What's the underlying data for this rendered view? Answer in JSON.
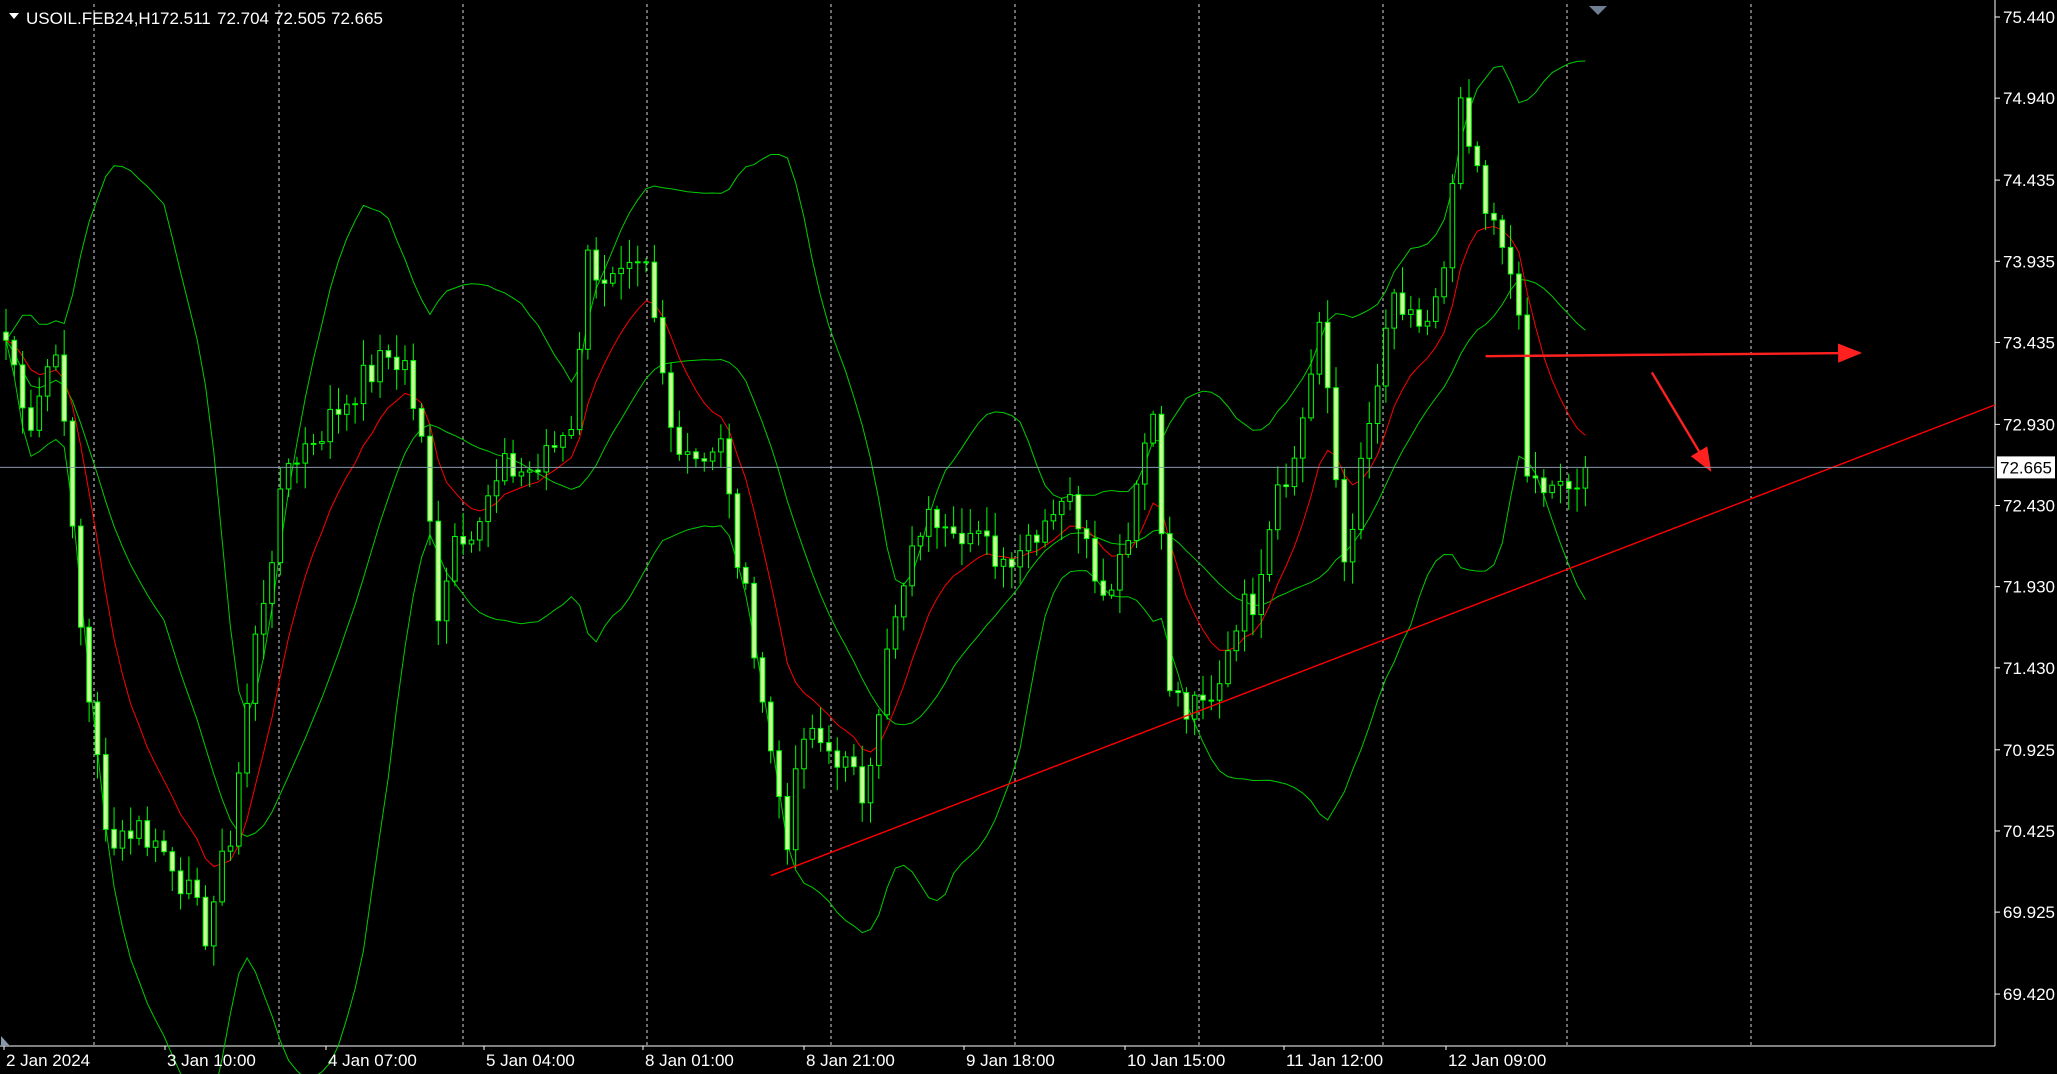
{
  "window": {
    "symbol_label": "USOIL.FEB24,H1",
    "ohlc": {
      "open": "72.511",
      "high": "72.704",
      "low": "72.505",
      "close": "72.665"
    },
    "current_price_label": "72.665"
  },
  "colors": {
    "background": "#000000",
    "grid": "#ffffff",
    "candle": "#00ff00",
    "candle_bull_body": "#000000",
    "candle_bear_body": "#ccff99",
    "bollinger": "#00cc00",
    "moving_average": "#ff0000",
    "trendline": "#ff0000",
    "arrow": "#ff2020",
    "price_line": "#8899aa"
  },
  "chart_data": {
    "type": "candlestick",
    "ylim": [
      69.1,
      75.52
    ],
    "y_ticks": [
      "75.440",
      "74.940",
      "74.435",
      "73.935",
      "73.435",
      "72.930",
      "72.430",
      "71.930",
      "71.430",
      "70.925",
      "70.425",
      "69.925",
      "69.420"
    ],
    "x_labels": [
      "2 Jan 2024",
      "3 Jan 10:00",
      "4 Jan 07:00",
      "5 Jan 04:00",
      "8 Jan 01:00",
      "8 Jan 21:00",
      "9 Jan 18:00",
      "10 Jan 15:00",
      "11 Jan 12:00",
      "12 Jan 09:00"
    ],
    "current_price": 72.665,
    "bars_visible": 240,
    "anchors": [
      [
        0,
        73.45
      ],
      [
        3,
        72.95
      ],
      [
        6,
        73.45
      ],
      [
        9,
        71.7
      ],
      [
        12,
        70.4
      ],
      [
        16,
        70.45
      ],
      [
        20,
        70.25
      ],
      [
        24,
        69.8
      ],
      [
        27,
        70.4
      ],
      [
        30,
        71.6
      ],
      [
        34,
        72.7
      ],
      [
        38,
        72.9
      ],
      [
        42,
        73.15
      ],
      [
        46,
        73.35
      ],
      [
        48,
        73.3
      ],
      [
        50,
        72.8
      ],
      [
        52,
        71.8
      ],
      [
        54,
        72.25
      ],
      [
        57,
        72.35
      ],
      [
        60,
        72.65
      ],
      [
        64,
        72.65
      ],
      [
        68,
        72.95
      ],
      [
        70,
        73.95
      ],
      [
        73,
        73.8
      ],
      [
        77,
        73.85
      ],
      [
        80,
        72.9
      ],
      [
        83,
        72.75
      ],
      [
        86,
        72.8
      ],
      [
        88,
        72.1
      ],
      [
        90,
        71.6
      ],
      [
        92,
        70.9
      ],
      [
        94,
        70.4
      ],
      [
        96,
        71.0
      ],
      [
        100,
        70.9
      ],
      [
        103,
        70.65
      ],
      [
        106,
        71.5
      ],
      [
        110,
        72.3
      ],
      [
        113,
        72.4
      ],
      [
        117,
        72.2
      ],
      [
        120,
        72.1
      ],
      [
        124,
        72.3
      ],
      [
        127,
        72.5
      ],
      [
        130,
        72.3
      ],
      [
        132,
        71.85
      ],
      [
        135,
        72.3
      ],
      [
        138,
        73.1
      ],
      [
        140,
        71.3
      ],
      [
        142,
        71.15
      ],
      [
        145,
        71.2
      ],
      [
        148,
        71.75
      ],
      [
        150,
        71.85
      ],
      [
        153,
        72.6
      ],
      [
        155,
        72.7
      ],
      [
        158,
        73.55
      ],
      [
        161,
        72.1
      ],
      [
        164,
        72.9
      ],
      [
        167,
        73.7
      ],
      [
        170,
        73.45
      ],
      [
        173,
        73.85
      ],
      [
        175,
        74.85
      ],
      [
        178,
        74.2
      ],
      [
        181,
        73.95
      ],
      [
        182,
        73.5
      ],
      [
        183,
        72.6
      ],
      [
        186,
        72.5
      ],
      [
        189,
        72.55
      ],
      [
        190,
        72.665
      ]
    ],
    "ma_period": 20,
    "bb_period": 20,
    "bb_deviation": 2,
    "annotations": [
      {
        "type": "trendline",
        "from": [
          92,
          70.15
        ],
        "to": [
          240,
          73.05
        ]
      },
      {
        "type": "horizontal_arrow",
        "from": [
          178,
          73.35
        ],
        "to": [
          223,
          73.37
        ]
      },
      {
        "type": "diagonal_arrow",
        "from": [
          198,
          73.25
        ],
        "to": [
          205,
          72.65
        ]
      }
    ]
  }
}
